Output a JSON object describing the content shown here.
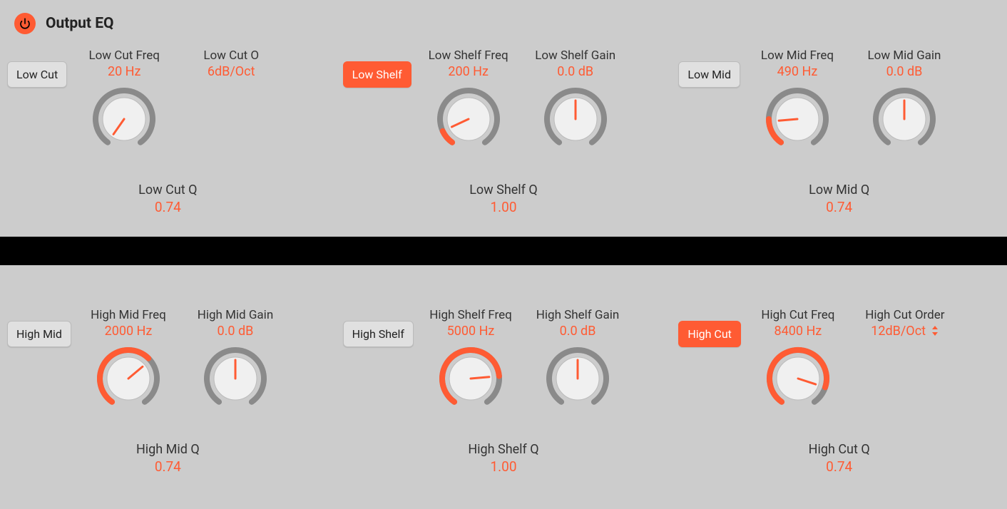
{
  "header": {
    "title": "Output EQ"
  },
  "colors": {
    "accent": "#ff5b33",
    "panel_bg": "#cccccc",
    "knob_ring": "#8a8a8a",
    "knob_face_top": "#fafafa",
    "knob_face_bottom": "#d6d6d6"
  },
  "bands": {
    "low_cut": {
      "button": "Low Cut",
      "active": false,
      "freq_label": "Low Cut Freq",
      "freq_value": "20 Hz",
      "freq_angle": -145,
      "freq_fill_deg": 0,
      "extra_label": "Low Cut O",
      "extra_value": "6dB/Oct",
      "q_label": "Low Cut Q",
      "q_value": "0.74"
    },
    "low_shelf": {
      "button": "Low Shelf",
      "active": true,
      "freq_label": "Low Shelf Freq",
      "freq_value": "200 Hz",
      "freq_angle": -115,
      "freq_fill_deg": 30,
      "gain_label": "Low Shelf Gain",
      "gain_value": "0.0 dB",
      "gain_angle": 0,
      "gain_fill_deg": 0,
      "q_label": "Low Shelf Q",
      "q_value": "1.00"
    },
    "low_mid": {
      "button": "Low Mid",
      "active": false,
      "freq_label": "Low Mid Freq",
      "freq_value": "490 Hz",
      "freq_angle": -95,
      "freq_fill_deg": 55,
      "gain_label": "Low Mid Gain",
      "gain_value": "0.0 dB",
      "gain_angle": 0,
      "gain_fill_deg": 0,
      "q_label": "Low Mid Q",
      "q_value": "0.74"
    },
    "high_mid": {
      "button": "High Mid",
      "active": false,
      "freq_label": "High Mid Freq",
      "freq_value": "2000 Hz",
      "freq_angle": 50,
      "freq_fill_deg": 190,
      "gain_label": "High Mid Gain",
      "gain_value": "0.0 dB",
      "gain_angle": 0,
      "gain_fill_deg": 0,
      "q_label": "High Mid Q",
      "q_value": "0.74"
    },
    "high_shelf": {
      "button": "High Shelf",
      "active": false,
      "freq_label": "High Shelf Freq",
      "freq_value": "5000 Hz",
      "freq_angle": 85,
      "freq_fill_deg": 230,
      "gain_label": "High Shelf Gain",
      "gain_value": "0.0 dB",
      "gain_angle": 0,
      "gain_fill_deg": 0,
      "q_label": "High Shelf Q",
      "q_value": "1.00"
    },
    "high_cut": {
      "button": "High Cut",
      "active": true,
      "freq_label": "High Cut Freq",
      "freq_value": "8400 Hz",
      "freq_angle": 108,
      "freq_fill_deg": 253,
      "extra_label": "High Cut Order",
      "extra_value": "12dB/Oct",
      "q_label": "High Cut Q",
      "q_value": "0.74"
    }
  }
}
